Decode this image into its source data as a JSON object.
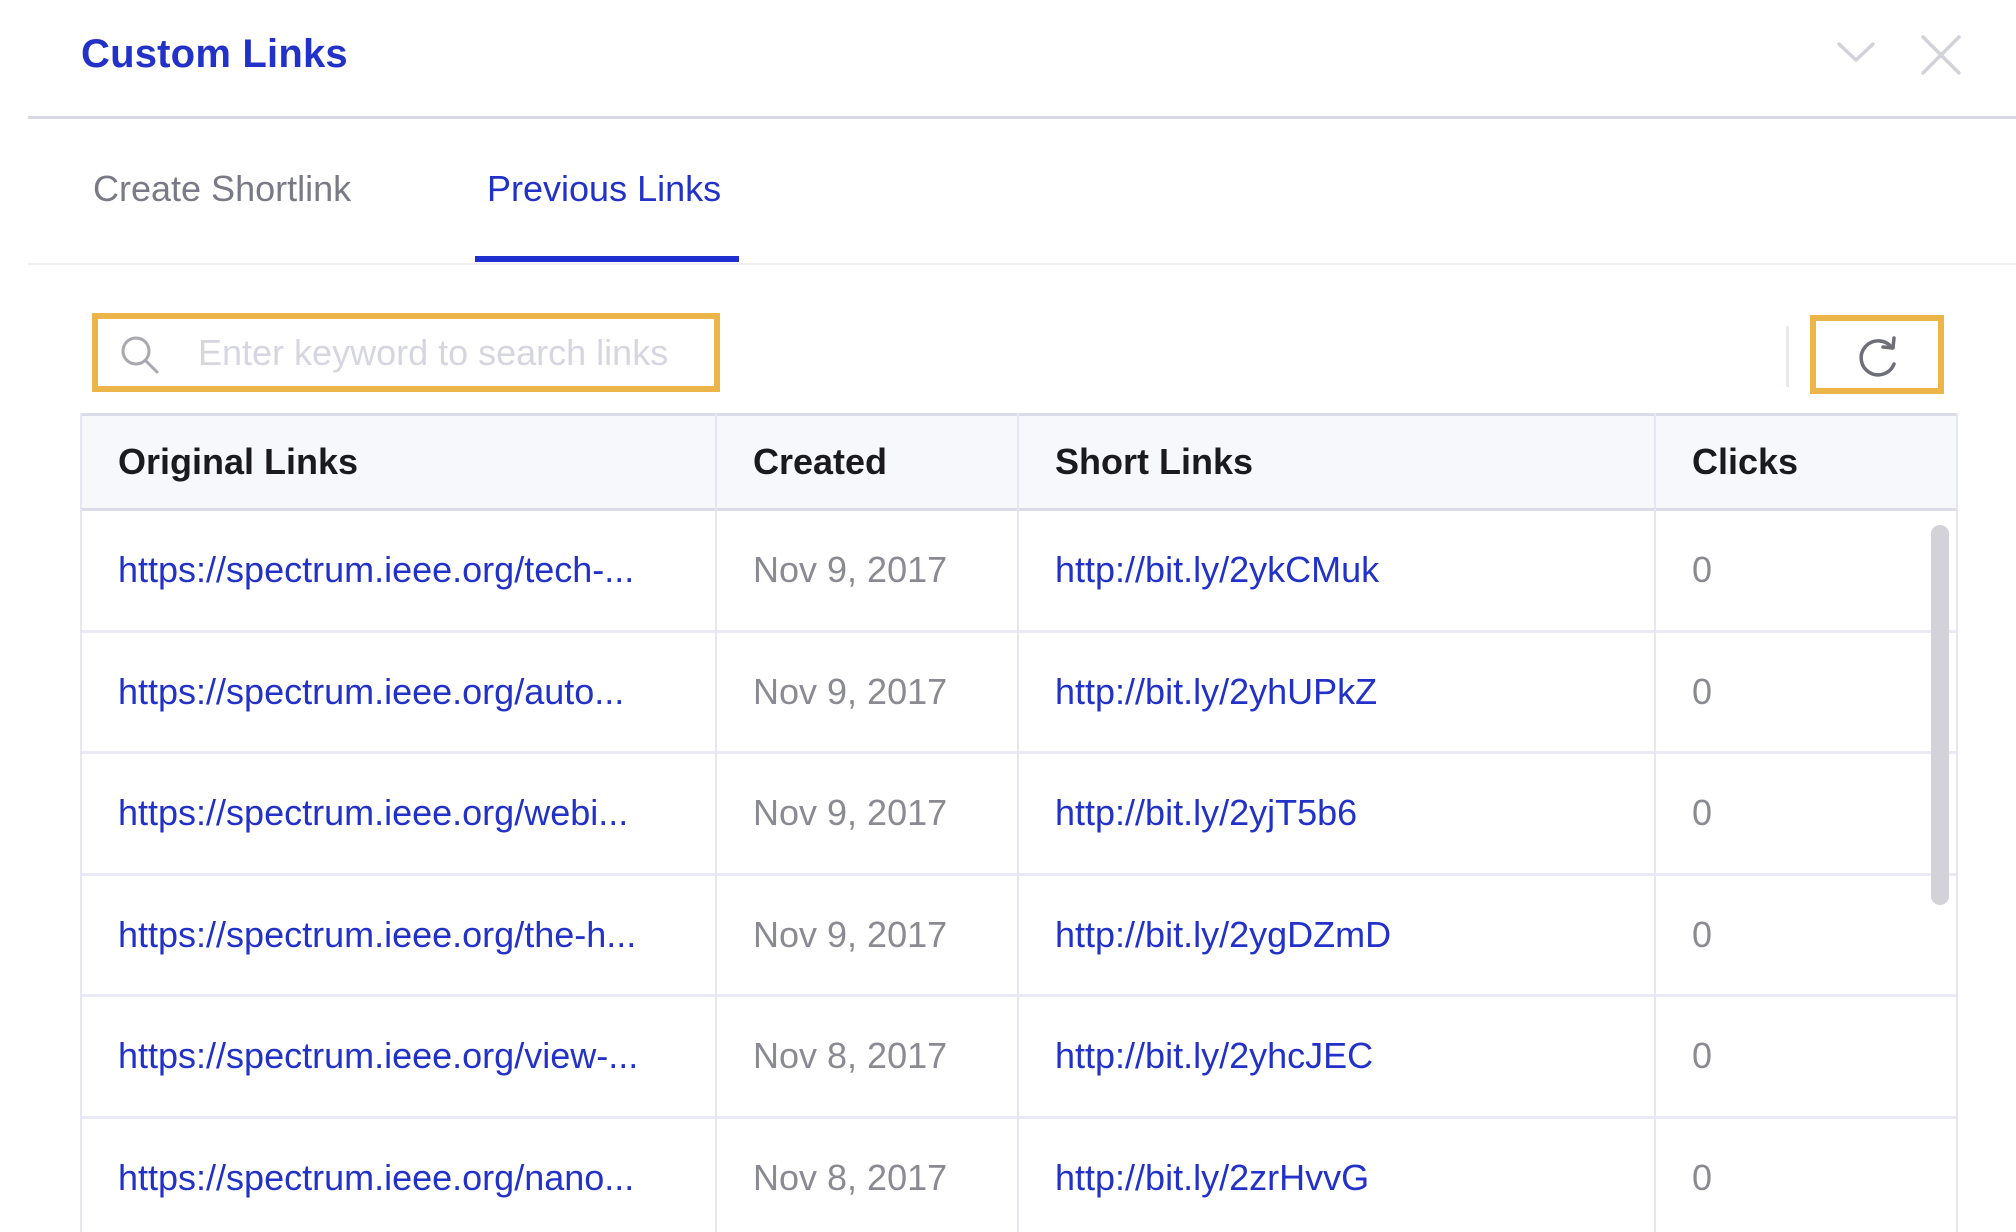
{
  "header": {
    "title": "Custom Links",
    "collapse_icon": "chevron-down-icon",
    "close_icon": "close-icon"
  },
  "tabs": [
    {
      "label": "Create Shortlink",
      "active": false
    },
    {
      "label": "Previous Links",
      "active": true
    }
  ],
  "toolbar": {
    "search": {
      "placeholder": "Enter keyword to search links",
      "value": "",
      "icon": "search-icon"
    },
    "refresh_icon": "refresh-icon",
    "highlight_color": "#EBB54A"
  },
  "table": {
    "columns": [
      "Original Links",
      "Created",
      "Short Links",
      "Clicks"
    ],
    "rows": [
      {
        "original": "https://spectrum.ieee.org/tech-...",
        "created": "Nov 9, 2017",
        "short": "http://bit.ly/2ykCMuk",
        "clicks": "0"
      },
      {
        "original": "https://spectrum.ieee.org/auto...",
        "created": "Nov 9, 2017",
        "short": "http://bit.ly/2yhUPkZ",
        "clicks": "0"
      },
      {
        "original": "https://spectrum.ieee.org/webi...",
        "created": "Nov 9, 2017",
        "short": "http://bit.ly/2yjT5b6",
        "clicks": "0"
      },
      {
        "original": "https://spectrum.ieee.org/the-h...",
        "created": "Nov 9, 2017",
        "short": "http://bit.ly/2ygDZmD",
        "clicks": "0"
      },
      {
        "original": "https://spectrum.ieee.org/view-...",
        "created": "Nov 8, 2017",
        "short": "http://bit.ly/2yhcJEC",
        "clicks": "0"
      },
      {
        "original": "https://spectrum.ieee.org/nano...",
        "created": "Nov 8, 2017",
        "short": "http://bit.ly/2zrHvvG",
        "clicks": "0"
      }
    ]
  },
  "colors": {
    "accent": "#2231C8",
    "tab_underline": "#1F2ECF",
    "muted_text": "#8A8A92",
    "header_bg": "#F7F8FC"
  }
}
